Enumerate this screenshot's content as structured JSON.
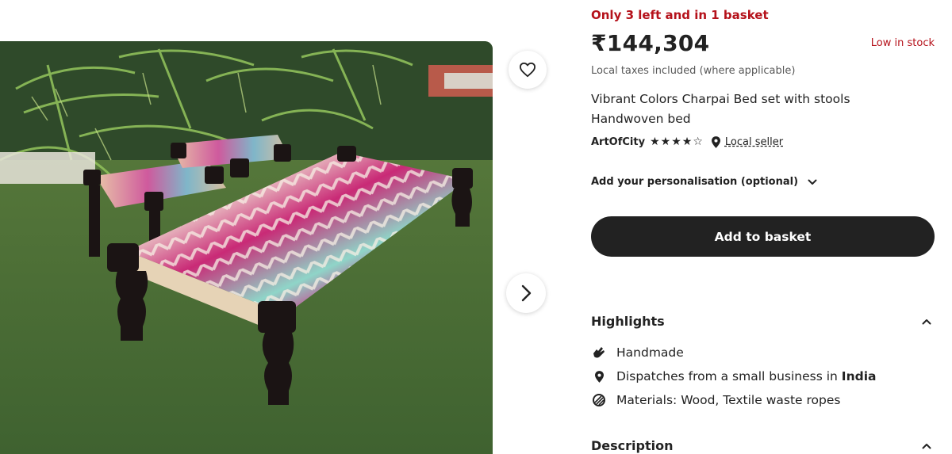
{
  "gallery": {
    "favorite_icon": "heart-outline-icon",
    "next_icon": "chevron-right-icon"
  },
  "listing": {
    "stock_alert": "Only 3 left and in 1 basket",
    "price": "₹144,304",
    "low_stock": "Low in stock",
    "tax_note": "Local taxes included (where applicable)",
    "title_line_1": "Vibrant Colors Charpai Bed set with stools",
    "title_line_2": "Handwoven bed",
    "seller": {
      "name": "ArtOfCity",
      "rating": 4,
      "rating_max": 5,
      "local_seller_label": "Local seller"
    },
    "personalisation_label": "Add your personalisation (optional)",
    "add_to_basket_label": "Add to basket"
  },
  "highlights": {
    "title": "Highlights",
    "items": [
      {
        "icon": "hand-icon",
        "text": "Handmade"
      },
      {
        "icon": "location-pin-icon",
        "text_prefix": "Dispatches from a small business in ",
        "text_bold": "India"
      },
      {
        "icon": "materials-icon",
        "text": "Materials: Wood, Textile waste ropes"
      }
    ]
  },
  "description": {
    "title": "Description"
  },
  "colors": {
    "alert_red": "#b5121b",
    "button_dark": "#222222",
    "text_primary": "#222222",
    "text_secondary": "#595959"
  }
}
